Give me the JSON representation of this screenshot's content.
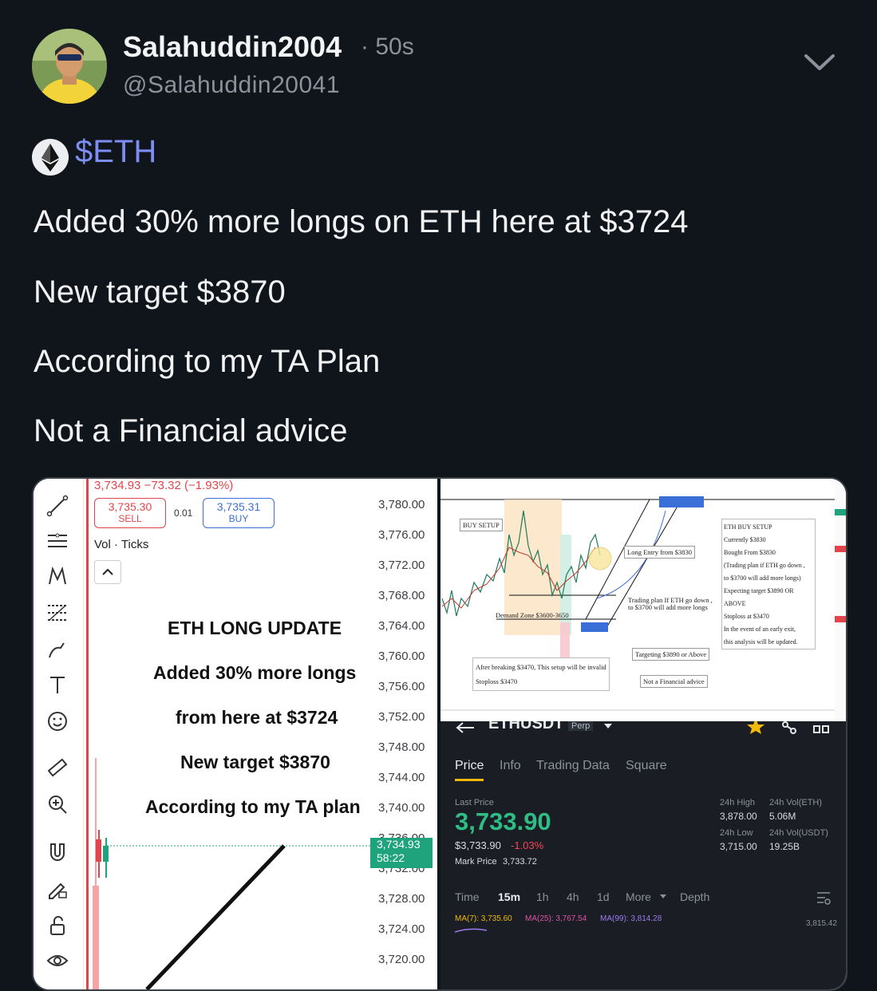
{
  "post": {
    "display_name": "Salahuddin2004",
    "time": "· 50s",
    "handle": "@Salahuddin20041",
    "ticker": "$ETH",
    "lines": [
      "Added 30% more longs on ETH here at $3724",
      "New target $3870",
      "According to my TA Plan",
      "Not a Financial advice"
    ]
  },
  "icons": {
    "chevron": "chevron-down-icon",
    "eth": "ethereum-icon"
  },
  "left_panel": {
    "price_header": "3,734.93 −73.32 (−1.93%)",
    "sell_price": "3,735.30",
    "sell_label": "SELL",
    "spread": "0.01",
    "buy_price": "3,735.31",
    "buy_label": "BUY",
    "vol_ticks": "Vol · Ticks",
    "overlay": [
      "ETH LONG UPDATE",
      "Added 30% more longs",
      "from here at $3724",
      "New target $3870",
      "According to my TA plan"
    ],
    "price_scale": [
      "3,780.00",
      "3,776.00",
      "3,772.00",
      "3,768.00",
      "3,764.00",
      "3,760.00",
      "3,756.00",
      "3,752.00",
      "3,748.00",
      "3,744.00",
      "3,740.00",
      "3,736.00",
      "3,732.00",
      "3,728.00",
      "3,724.00",
      "3,720.00"
    ],
    "current_price": "3,734.93",
    "countdown": "58:22",
    "colors": {
      "sell": "#e0454b",
      "buy": "#3b6fd8",
      "current": "#1fa37c"
    }
  },
  "tv_panel": {
    "labels": {
      "buy_setup": "BUY SETUP",
      "long_entry": "Long Entry from $3830",
      "demand_zone": "Demand Zone $3600-3650",
      "trading_plan": "Trading plan If ETH go down ,",
      "trading_plan_2": "to $3700 will add more longs",
      "targeting": "Targeting $3890 or Above",
      "after_breaking": "After breaking $3470, This setup will be invalid",
      "stoploss": "Stoploss $3470",
      "not_advice": "Not a Financial advice"
    },
    "notes": [
      "ETH BUY SETUP",
      "Currently $3830",
      "Bought From $3830",
      "(Trading plan if ETH go down ,",
      "to $3700 will add more longs)",
      "Expecting target $3890 OR ABOVE",
      "Stoploss at $3470",
      "In the event of an early exit,",
      "this analysis will be updated."
    ]
  },
  "binance": {
    "pair": "ETHUSDT",
    "perp": "Perp",
    "tabs": [
      "Price",
      "Info",
      "Trading Data",
      "Square"
    ],
    "last_price_label": "Last Price",
    "last_price": "3,733.90",
    "usd_price": "$3,733.90",
    "change": "-1.03%",
    "mark_price_label": "Mark Price",
    "mark_price": "3,733.72",
    "high_label": "24h High",
    "high": "3,878.00",
    "vol_eth_label": "24h Vol(ETH)",
    "vol_eth": "5.06M",
    "low_label": "24h Low",
    "low": "3,715.00",
    "vol_usdt_label": "24h Vol(USDT)",
    "vol_usdt": "19.25B",
    "intervals": [
      "Time",
      "15m",
      "1h",
      "4h",
      "1d",
      "More",
      "Depth"
    ],
    "ma7": "MA(7): 3,735.60",
    "ma25": "MA(25): 3,767.54",
    "ma99": "MA(99): 3,814.28",
    "right_price": "3,815.42",
    "colors": {
      "green": "#2ebd85",
      "red": "#f6465d",
      "yellow": "#f0b90b"
    }
  }
}
